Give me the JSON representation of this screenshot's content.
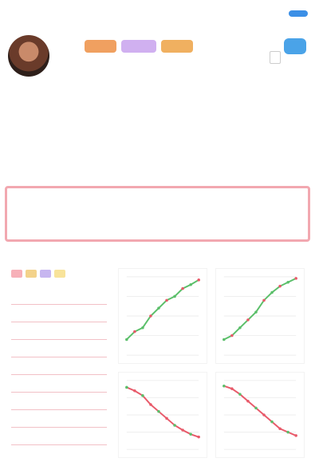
{
  "topbar": {
    "time": "",
    "action_label": ""
  },
  "profile": {
    "name": "",
    "meta_line_1": "",
    "meta_line_2": "",
    "badges": [
      "",
      "",
      ""
    ]
  },
  "post": {
    "link_text": "",
    "body": ""
  },
  "quote": {
    "heading": "",
    "text": "",
    "tail": ""
  },
  "panel": {
    "list_items": [
      "",
      "",
      "",
      "",
      "",
      "",
      "",
      "",
      ""
    ]
  },
  "colors": {
    "accent": "#3b8fe6",
    "quote_border": "#f2a8b0",
    "up": "#5bbf6a",
    "down": "#e85a6a"
  },
  "chart_data": [
    {
      "type": "line",
      "title": "",
      "xlabel": "",
      "ylabel": "",
      "x": [
        1,
        2,
        3,
        4,
        5,
        6,
        7,
        8,
        9,
        10
      ],
      "series": [
        {
          "values": [
            2,
            3,
            3.5,
            5,
            6,
            7,
            7.5,
            8.5,
            9,
            9.6
          ]
        }
      ]
    },
    {
      "type": "line",
      "title": "",
      "xlabel": "",
      "ylabel": "",
      "x": [
        1,
        2,
        3,
        4,
        5,
        6,
        7,
        8,
        9,
        10
      ],
      "series": [
        {
          "values": [
            2,
            2.5,
            3.5,
            4.5,
            5.5,
            7,
            8,
            8.8,
            9.3,
            9.8
          ]
        }
      ]
    },
    {
      "type": "line",
      "title": "",
      "xlabel": "",
      "ylabel": "",
      "x": [
        1,
        2,
        3,
        4,
        5,
        6,
        7,
        8,
        9,
        10
      ],
      "series": [
        {
          "values": [
            9,
            8.5,
            7.8,
            6.5,
            5.5,
            4.5,
            3.5,
            2.8,
            2.2,
            1.8
          ]
        }
      ]
    },
    {
      "type": "line",
      "title": "",
      "xlabel": "",
      "ylabel": "",
      "x": [
        1,
        2,
        3,
        4,
        5,
        6,
        7,
        8,
        9,
        10
      ],
      "series": [
        {
          "values": [
            9.2,
            8.8,
            8,
            7,
            6,
            5,
            4,
            3,
            2.5,
            2
          ]
        }
      ]
    }
  ]
}
